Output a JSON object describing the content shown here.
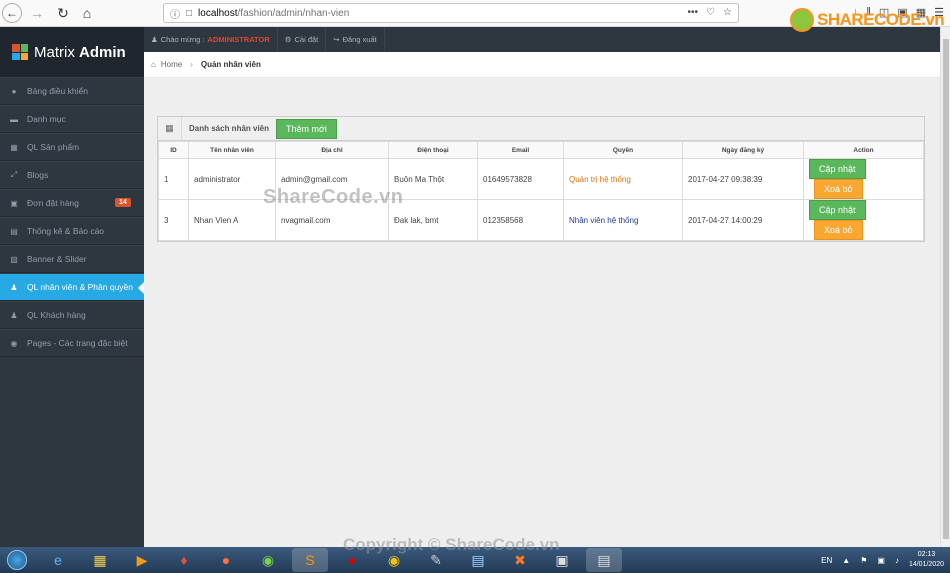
{
  "browser": {
    "url_host": "localhost",
    "url_path": "/fashion/admin/nhan-vien",
    "sharecode_logo": "SHARECODE.vn"
  },
  "brand": {
    "part1": "Matrix",
    "part2": "Admin"
  },
  "sidebar": {
    "items": [
      {
        "label": "Bảng điều khiển",
        "icon": "home-icon"
      },
      {
        "label": "Danh mục",
        "icon": "folder-icon"
      },
      {
        "label": "QL Sản phẩm",
        "icon": "grid-icon"
      },
      {
        "label": "Blogs",
        "icon": "fullscreen-icon"
      },
      {
        "label": "Đơn đặt hàng",
        "icon": "cart-icon",
        "badge": "14"
      },
      {
        "label": "Thống kê & Báo cáo",
        "icon": "chart-icon"
      },
      {
        "label": "Banner & Slider",
        "icon": "film-icon"
      },
      {
        "label": "QL nhân viên & Phân quyền",
        "icon": "user-icon",
        "active": true
      },
      {
        "label": "QL Khách hàng",
        "icon": "user-icon"
      },
      {
        "label": "Pages - Các trang đặc biệt",
        "icon": "info-icon"
      }
    ]
  },
  "topbar": {
    "greeting": "Chào mừng :",
    "username": "ADMINISTRATOR",
    "settings": "Cài đặt",
    "logout": "Đăng xuất"
  },
  "breadcrumb": {
    "home": "Home",
    "current": "Quản nhân viên"
  },
  "panel": {
    "title": "Danh sách nhân viên",
    "add_button": "Thêm mới",
    "columns": [
      "ID",
      "Tên nhân viên",
      "Địa chỉ",
      "Điện thoại",
      "Email",
      "Quyền",
      "Ngày đăng ký",
      "Action"
    ],
    "rows": [
      {
        "id": "1",
        "name": "administrator",
        "address": "admin@gmail.com",
        "phone": "Buôn Ma Thột",
        "email": "01649573828",
        "role": "Quản trị hệ thống",
        "role_type": "admin",
        "date": "2017-04-27 09:38:39",
        "update": "Cập nhật",
        "delete": "Xoá bỏ"
      },
      {
        "id": "3",
        "name": "Nhan Vien A",
        "address": "nvagmail.com",
        "phone": "Đak lak, bmt",
        "email": "012358568",
        "role": "Nhân viên hệ thống",
        "role_type": "staff",
        "date": "2017-04-27 14:00:29",
        "update": "Cập nhật",
        "delete": "Xoá bỏ"
      }
    ]
  },
  "watermark": "ShareCode.vn",
  "copyright": "Copyright © ShareCode.vn",
  "taskbar": {
    "lang": "EN",
    "time": "02:13",
    "date": "14/01/2020"
  },
  "colors": {
    "sidebar_bg": "#2e363f",
    "active": "#27a9e3",
    "green": "#5bb75b",
    "orange": "#faa732",
    "badge": "#da542e"
  }
}
